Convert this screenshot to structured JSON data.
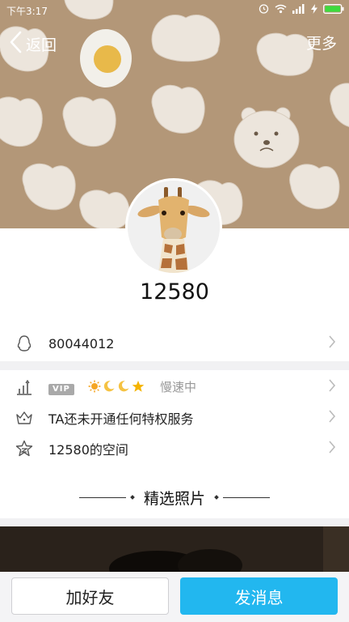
{
  "status_bar": {
    "time": "下午3:17",
    "icons": [
      "alarm-icon",
      "wifi-icon",
      "signal-icon",
      "charging-icon",
      "battery-icon"
    ]
  },
  "nav": {
    "back_label": "返回",
    "more_label": "更多"
  },
  "profile": {
    "name": "12580"
  },
  "info": {
    "qq_number": "80044012",
    "vip_badge": "VIP",
    "vip_level_icons": [
      "sun-icon",
      "moon-icon",
      "moon-icon",
      "star-icon"
    ],
    "vip_speed": "慢速中",
    "privilege_text": "TA还未开通任何特权服务",
    "space_text": "12580的空间"
  },
  "featured": {
    "title": "精选照片"
  },
  "actions": {
    "add_friend": "加好友",
    "send_message": "发消息"
  },
  "colors": {
    "banner_bg": "#b39778",
    "accent": "#22b7ef",
    "sun": "#f5a623",
    "moon": "#f5c242"
  }
}
